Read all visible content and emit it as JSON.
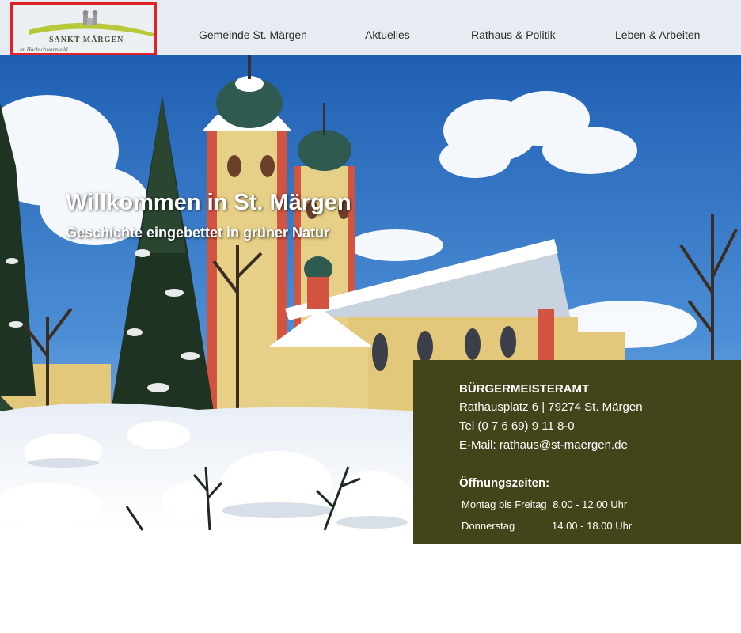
{
  "header": {
    "logo": {
      "title": "SANKT MÄRGEN",
      "subtitle": "im Hochschwarzwald",
      "accent_color": "#b7c93a"
    },
    "nav": [
      {
        "label": "Gemeinde St. Märgen"
      },
      {
        "label": "Aktuelles"
      },
      {
        "label": "Rathaus & Politik"
      },
      {
        "label": "Leben & Arbeiten"
      }
    ]
  },
  "hero": {
    "title": "Willkommen in St. Märgen",
    "subtitle": "Geschichte eingebettet in grüner Natur"
  },
  "contact": {
    "heading": "BÜRGERMEISTERAMT",
    "address": "Rathausplatz 6 | 79274 St. Märgen",
    "phone": "Tel (0 7 6 69) 9 11 8-0",
    "email": "E-Mail: rathaus@st-maergen.de",
    "hours_heading": "Öffnungszeiten:",
    "hours": [
      {
        "day": "Montag bis Freitag",
        "time": "8.00 - 12.00 Uhr"
      },
      {
        "day": "Donnerstag",
        "time": "14.00 - 18.00 Uhr"
      }
    ],
    "background_color": "#434419"
  }
}
